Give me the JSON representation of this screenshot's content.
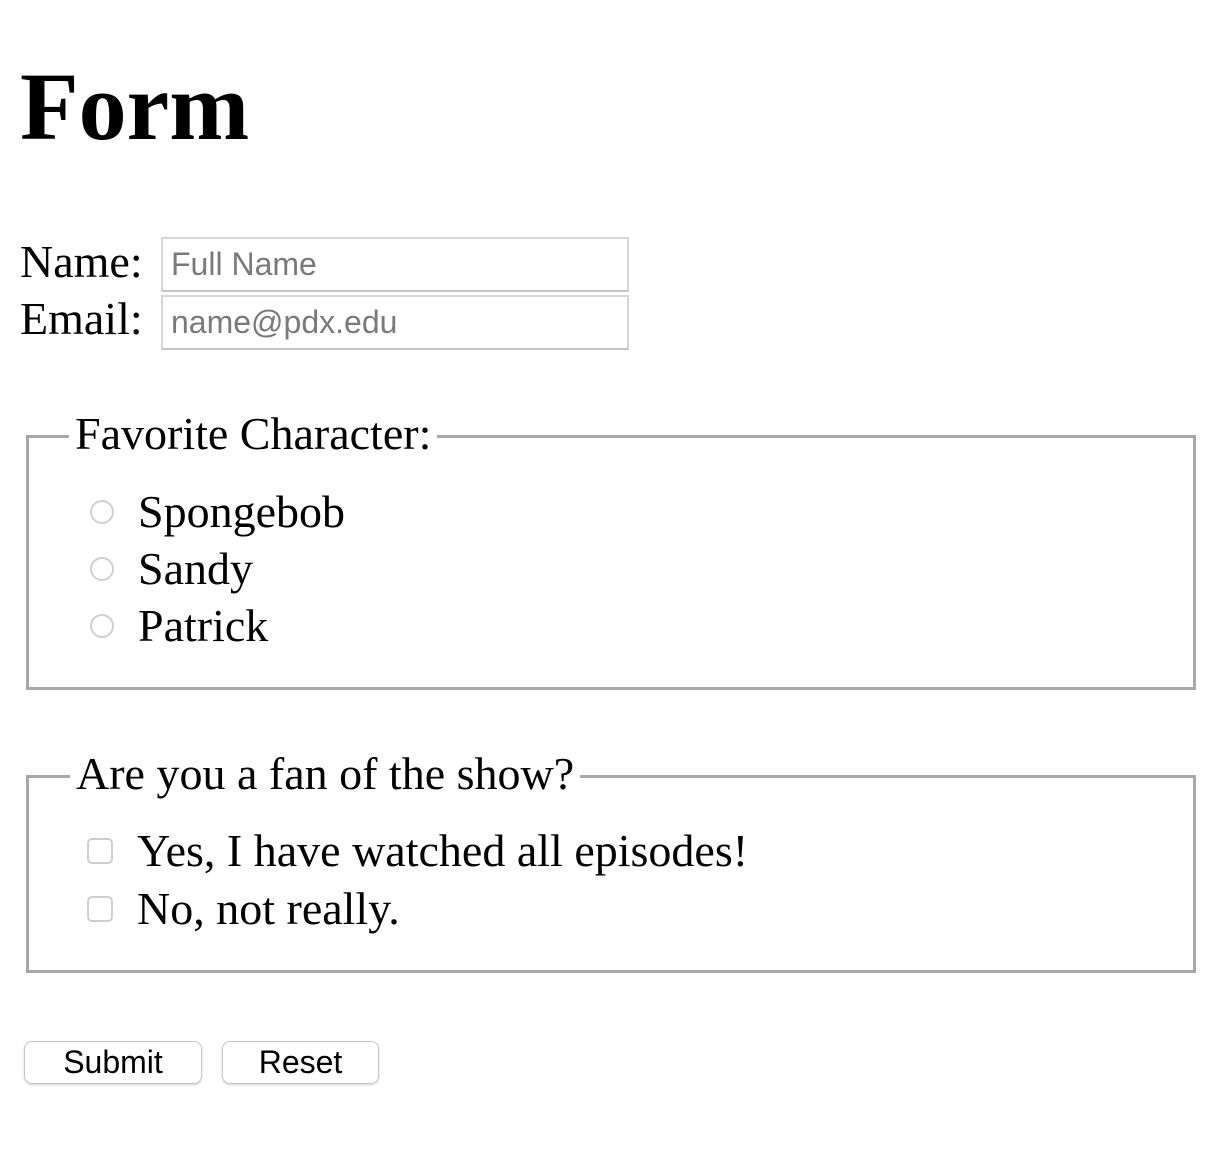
{
  "page": {
    "title": "Form"
  },
  "contact": {
    "name_label": "Name:",
    "name_placeholder": "Full Name",
    "name_value": "",
    "email_label": "Email:",
    "email_placeholder": "name@pdx.edu",
    "email_value": ""
  },
  "favorite_character": {
    "legend": "Favorite Character:",
    "options": [
      {
        "label": "Spongebob",
        "checked": false
      },
      {
        "label": "Sandy",
        "checked": false
      },
      {
        "label": "Patrick",
        "checked": false
      }
    ]
  },
  "fan_question": {
    "legend": "Are you a fan of the show?",
    "options": [
      {
        "label": "Yes, I have watched all episodes!",
        "checked": false
      },
      {
        "label": "No, not really.",
        "checked": false
      }
    ]
  },
  "buttons": {
    "submit_label": "Submit",
    "reset_label": "Reset"
  }
}
